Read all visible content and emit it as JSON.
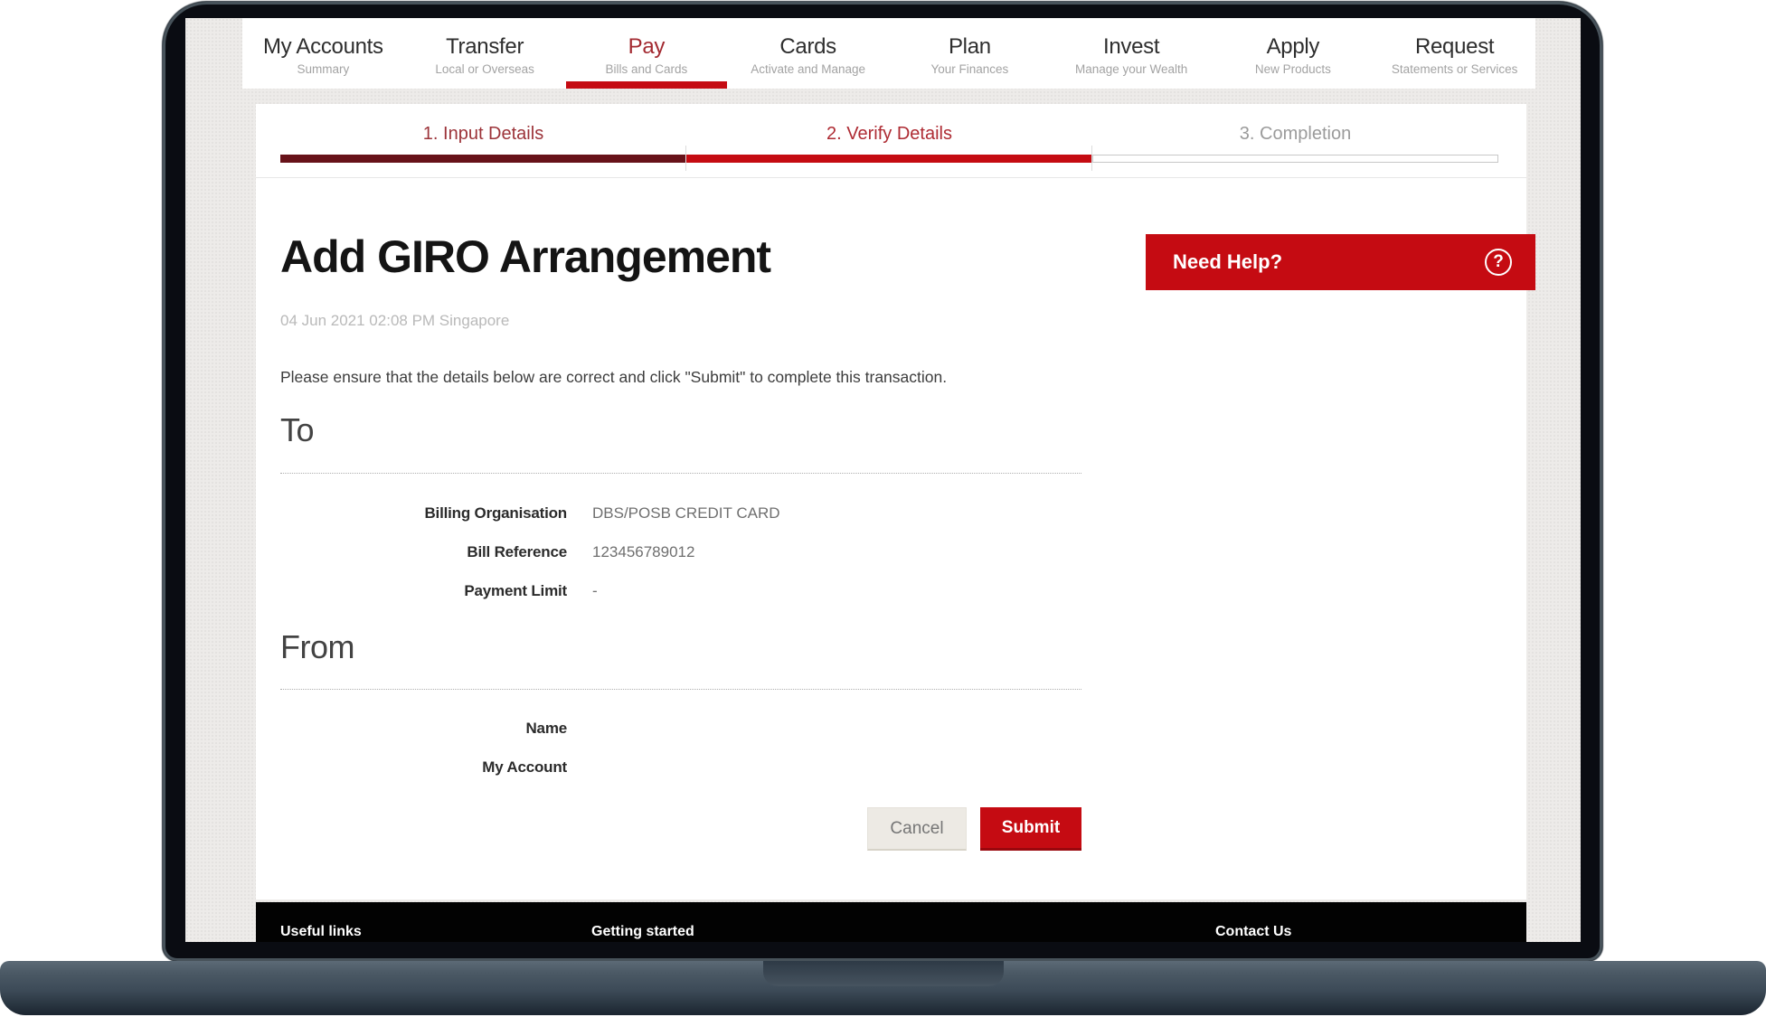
{
  "nav": {
    "items": [
      {
        "label": "My Accounts",
        "sublabel": "Summary",
        "active": false
      },
      {
        "label": "Transfer",
        "sublabel": "Local or Overseas",
        "active": false
      },
      {
        "label": "Pay",
        "sublabel": "Bills and Cards",
        "active": true
      },
      {
        "label": "Cards",
        "sublabel": "Activate and Manage",
        "active": false
      },
      {
        "label": "Plan",
        "sublabel": "Your Finances",
        "active": false
      },
      {
        "label": "Invest",
        "sublabel": "Manage your Wealth",
        "active": false
      },
      {
        "label": "Apply",
        "sublabel": "New Products",
        "active": false
      },
      {
        "label": "Request",
        "sublabel": "Statements or Services",
        "active": false
      }
    ]
  },
  "progress": {
    "steps": [
      {
        "label": "1. Input Details",
        "state": "done"
      },
      {
        "label": "2. Verify Details",
        "state": "active"
      },
      {
        "label": "3. Completion",
        "state": "pending"
      }
    ]
  },
  "page": {
    "title": "Add GIRO Arrangement",
    "timestamp": "04 Jun 2021 02:08 PM Singapore",
    "instruction": "Please ensure that the details below are correct and click \"Submit\" to complete this transaction."
  },
  "need_help": {
    "label": "Need Help?",
    "icon": "question-circle-icon",
    "icon_glyph": "?"
  },
  "sections": [
    {
      "heading": "To",
      "rows": [
        {
          "label": "Billing Organisation",
          "value": "DBS/POSB CREDIT CARD"
        },
        {
          "label": "Bill Reference",
          "value": "123456789012"
        },
        {
          "label": "Payment Limit",
          "value": "-"
        }
      ]
    },
    {
      "heading": "From",
      "rows": [
        {
          "label": "Name",
          "value": ""
        },
        {
          "label": "My Account",
          "value": ""
        }
      ]
    }
  ],
  "actions": {
    "cancel": "Cancel",
    "submit": "Submit"
  },
  "footer": {
    "columns": [
      "Useful links",
      "Getting started",
      "Contact Us"
    ]
  },
  "colors": {
    "brand_red": "#c50b12",
    "step_done_bar": "#671219",
    "active_nav_text": "#a32a31",
    "screen_background": "#edebe9",
    "footer_background": "#020202"
  }
}
